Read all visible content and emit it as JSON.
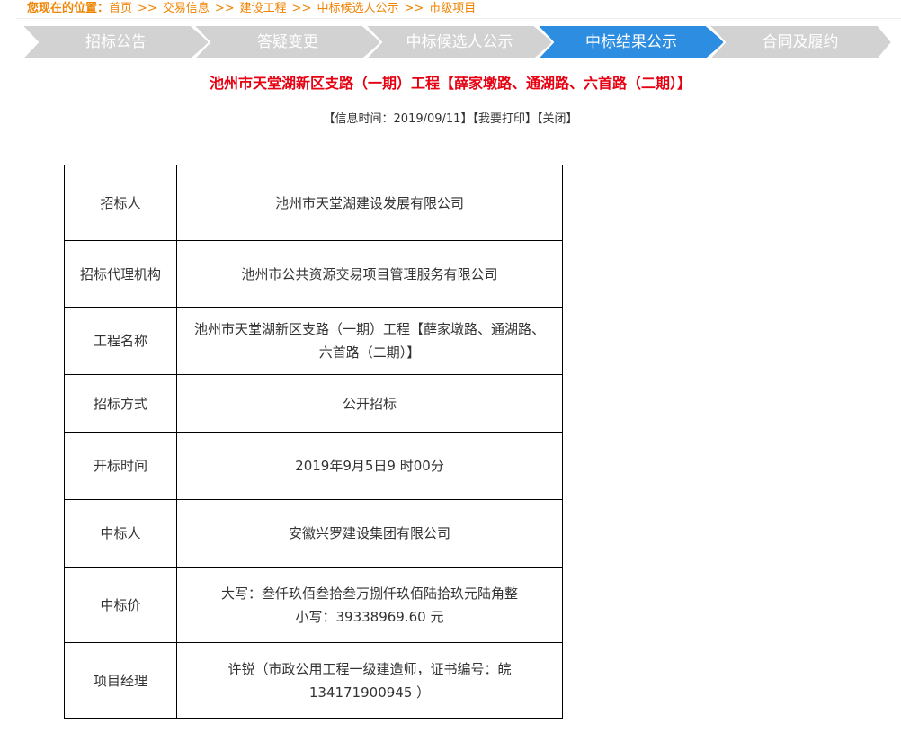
{
  "breadcrumb": {
    "lead": "您现在的位置：",
    "items": [
      "首页",
      "交易信息",
      "建设工程",
      "中标候选人公示",
      "市级项目"
    ],
    "separator": ">>"
  },
  "steps": [
    {
      "label": "招标公告",
      "active": false
    },
    {
      "label": "答疑变更",
      "active": false
    },
    {
      "label": "中标候选人公示",
      "active": false
    },
    {
      "label": "中标结果公示",
      "active": true
    },
    {
      "label": "合同及履约",
      "active": false
    }
  ],
  "colors": {
    "step_inactive": "#d2d2d2",
    "step_active": "#2d8de0",
    "accent": "#f08300",
    "title": "#e60012"
  },
  "title": "池州市天堂湖新区支路（一期）工程【薛家墩路、通湖路、六首路（二期）】",
  "meta": {
    "info_time": "【信息时间：2019/09/11】",
    "print": "【我要打印】",
    "close": "【关闭】"
  },
  "table": {
    "rows": [
      {
        "key": "招标人",
        "lines": [
          "池州市天堂湖建设发展有限公司"
        ]
      },
      {
        "key": "招标代理机构",
        "lines": [
          "池州市公共资源交易项目管理服务有限公司"
        ]
      },
      {
        "key": "工程名称",
        "lines": [
          "池州市天堂湖新区支路（一期）工程【薛家墩路、通湖路、",
          "六首路（二期）】"
        ]
      },
      {
        "key": "招标方式",
        "lines": [
          "公开招标"
        ]
      },
      {
        "key": "开标时间",
        "lines": [
          "2019年9月5日9 时00分"
        ]
      },
      {
        "key": "中标人",
        "lines": [
          "安徽兴罗建设集团有限公司"
        ]
      },
      {
        "key": "中标价",
        "lines": [
          "大写：叁仟玖佰叁拾叁万捌仟玖佰陆拾玖元陆角整",
          "小写：39338969.60 元"
        ]
      },
      {
        "key": "项目经理",
        "lines": [
          "许锐（市政公用工程一级建造师，证书编号：皖",
          "134171900945 ）"
        ]
      }
    ]
  }
}
